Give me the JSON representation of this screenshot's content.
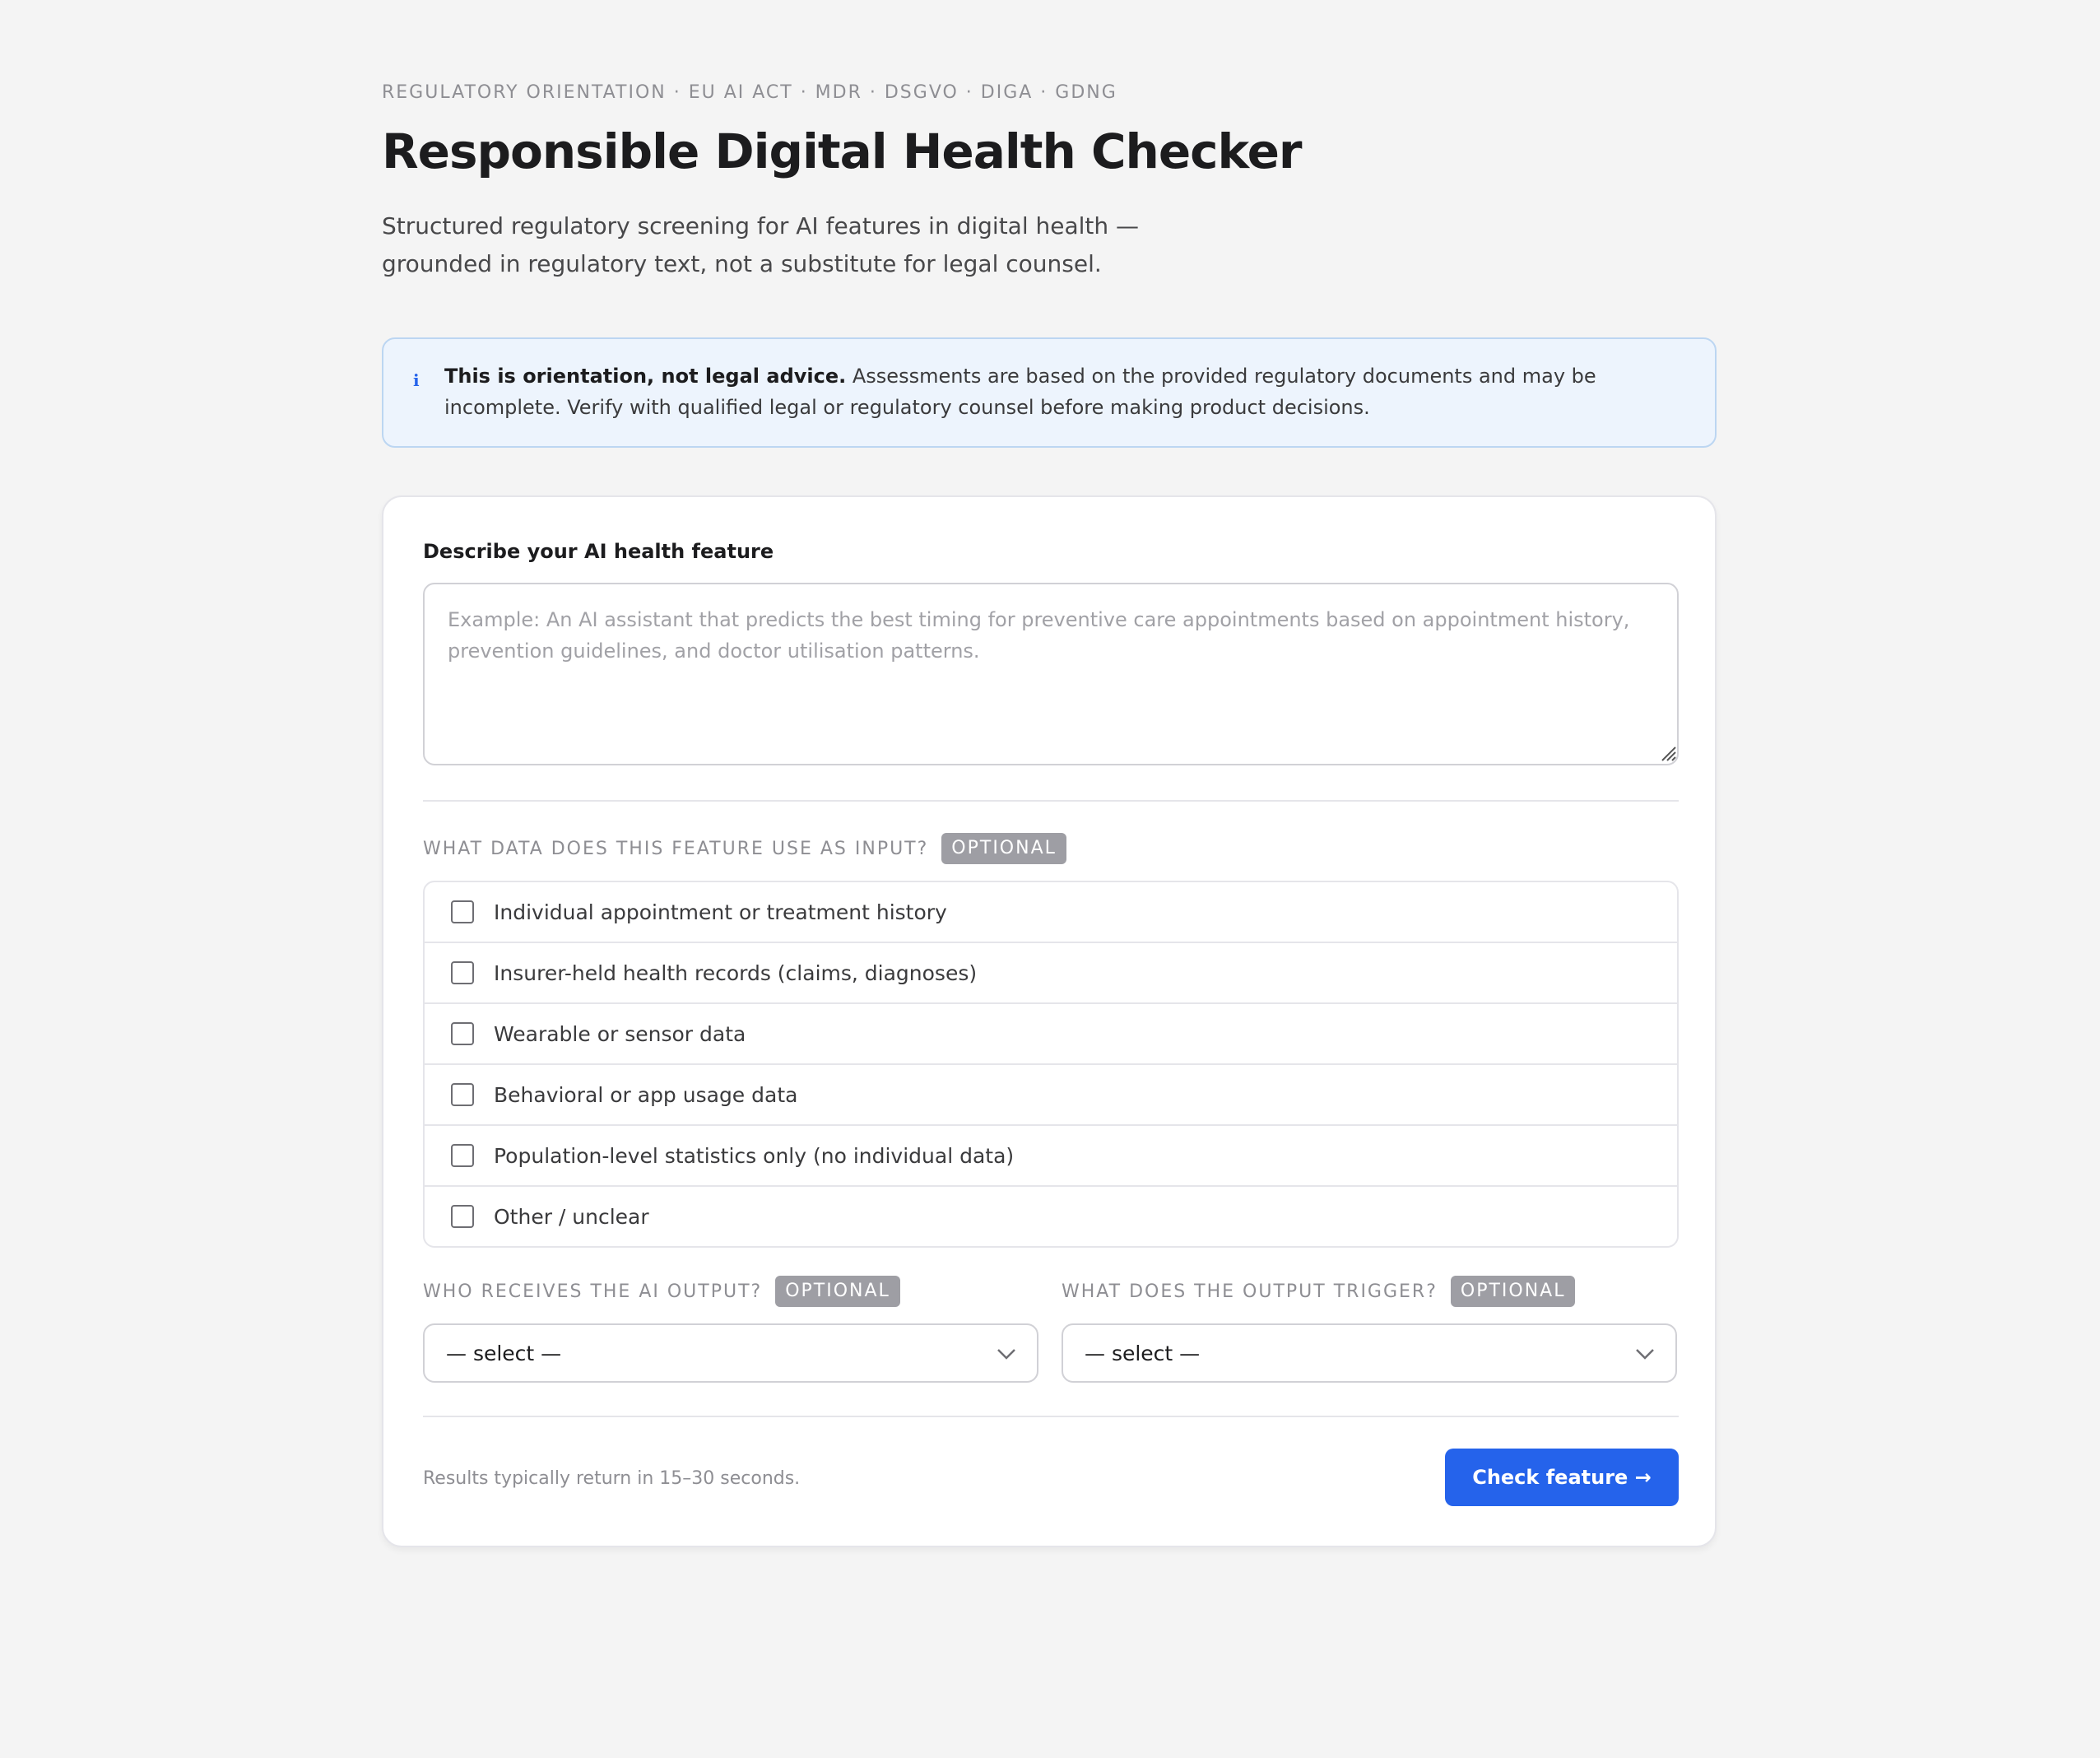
{
  "header": {
    "eyebrow": "REGULATORY ORIENTATION · EU AI ACT · MDR · DSGVO · DIGA · GDNG",
    "title": "Responsible Digital Health Checker",
    "subtitle": "Structured regulatory screening for AI features in digital health — grounded in regulatory text, not a substitute for legal counsel."
  },
  "notice": {
    "icon": "info-icon",
    "bold": "This is orientation, not legal advice.",
    "text": " Assessments are based on the provided regulatory documents and may be incomplete. Verify with qualified legal or regulatory counsel before making product decisions."
  },
  "form": {
    "description": {
      "label": "Describe your AI health feature",
      "value": "",
      "placeholder": "Example: An AI assistant that predicts the best timing for preventive care appointments based on appointment history, prevention guidelines, and doctor utilisation patterns."
    },
    "input_data": {
      "label": "WHAT DATA DOES THIS FEATURE USE AS INPUT?",
      "badge": "OPTIONAL",
      "options": [
        {
          "label": "Individual appointment or treatment history",
          "checked": false
        },
        {
          "label": "Insurer-held health records (claims, diagnoses)",
          "checked": false
        },
        {
          "label": "Wearable or sensor data",
          "checked": false
        },
        {
          "label": "Behavioral or app usage data",
          "checked": false
        },
        {
          "label": "Population-level statistics only (no individual data)",
          "checked": false
        },
        {
          "label": "Other / unclear",
          "checked": false
        }
      ]
    },
    "recipient": {
      "label": "WHO RECEIVES THE AI OUTPUT?",
      "badge": "OPTIONAL",
      "value": "— select —"
    },
    "trigger": {
      "label": "WHAT DOES THE OUTPUT TRIGGER?",
      "badge": "OPTIONAL",
      "value": "— select —"
    },
    "footer_note": "Results typically return in 15–30 seconds.",
    "submit_label": "Check feature →"
  },
  "colors": {
    "accent": "#2563eb",
    "background": "#f4f4f4",
    "notice_bg": "#edf4fd",
    "notice_border": "#bcd6f2",
    "badge_bg": "#9e9ea4"
  }
}
